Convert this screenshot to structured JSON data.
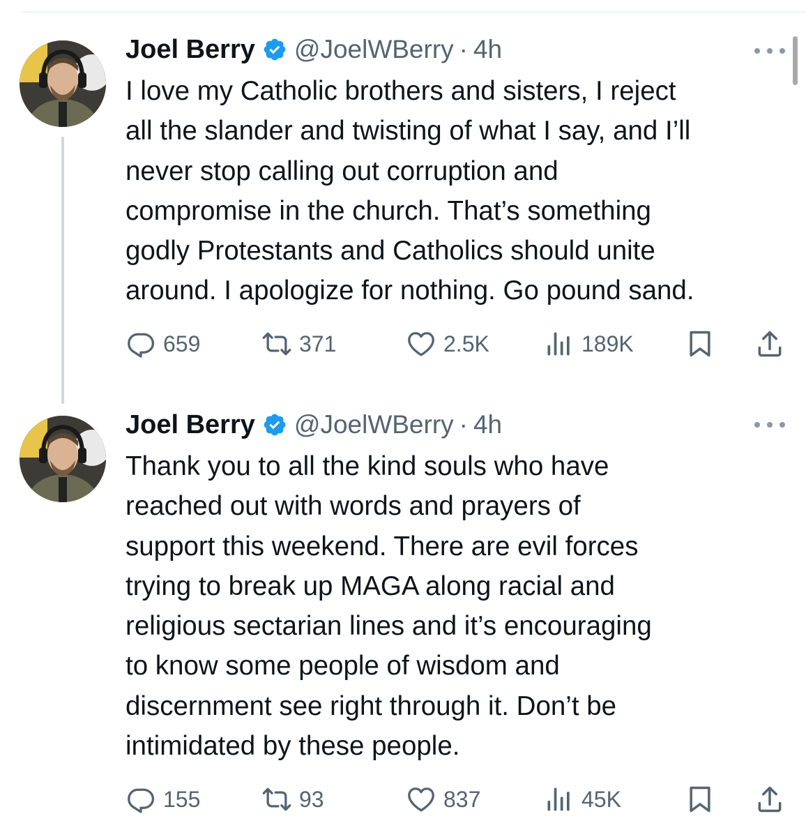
{
  "tweets": [
    {
      "name": "Joel Berry",
      "handle": "@JoelWBerry",
      "separator": "·",
      "time": "4h",
      "text": "I love my Catholic brothers and sisters, I reject\nall the slander and twisting of what I say, and I’ll\nnever stop calling out corruption and\ncompromise in the church. That’s something\ngodly Protestants and Catholics should unite\naround. I apologize for nothing. Go pound sand.",
      "replies": "659",
      "reposts": "371",
      "likes": "2.5K",
      "views": "189K"
    },
    {
      "name": "Joel Berry",
      "handle": "@JoelWBerry",
      "separator": "·",
      "time": "4h",
      "text": "Thank you to all the kind souls who have\nreached out with words and prayers of\nsupport this weekend. There are evil forces\ntrying to break up MAGA along racial and\nreligious sectarian lines and it’s encouraging\nto know some people of wisdom and\ndiscernment see right through it. Don’t be\nintimidated by these people.",
      "replies": "155",
      "reposts": "93",
      "likes": "837",
      "views": "45K"
    }
  ],
  "icons": {
    "reply": "reply-icon",
    "repost": "repost-icon",
    "like": "heart-icon",
    "views": "views-icon",
    "bookmark": "bookmark-icon",
    "share": "share-icon",
    "verified": "verified-badge-icon",
    "more": "more-options-icon"
  },
  "colors": {
    "verified": "#1d9bf0",
    "text": "#0f1419",
    "secondary": "#536471",
    "thread_line": "#cfd9de"
  }
}
